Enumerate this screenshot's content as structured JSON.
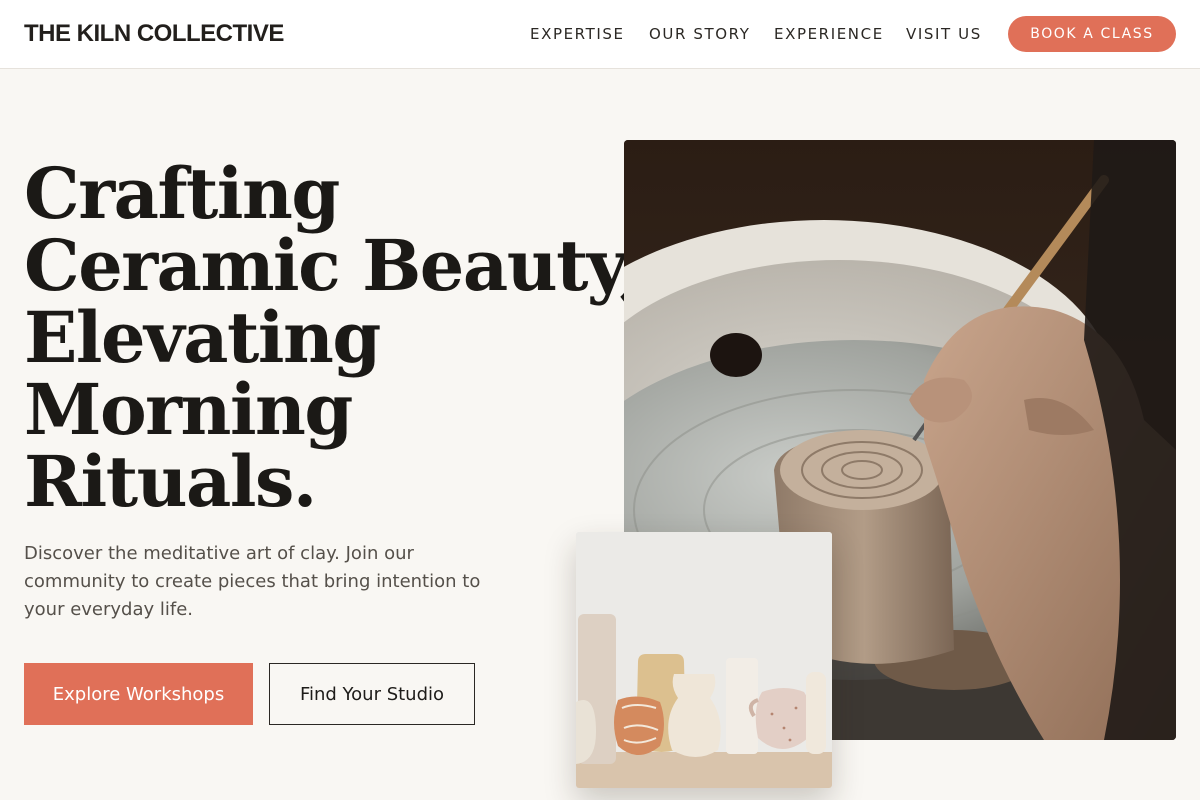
{
  "header": {
    "brand": "THE KILN COLLECTIVE",
    "nav": [
      "EXPERTISE",
      "OUR STORY",
      "EXPERIENCE",
      "VISIT US"
    ],
    "cta": "BOOK A CLASS"
  },
  "hero": {
    "headline": [
      "Crafting",
      "Ceramic Beauty,",
      "Elevating",
      "Morning",
      "Rituals."
    ],
    "description": "Discover the meditative art of clay. Join our community to create pieces that bring intention to your everyday life.",
    "primary_button": "Explore Workshops",
    "secondary_button": "Find Your Studio"
  },
  "colors": {
    "accent": "#e07058",
    "background": "#f9f7f3",
    "text": "#1b1916"
  },
  "images": {
    "main": "pottery-wheel-carving-photo",
    "secondary": "ceramic-vases-collection-photo"
  }
}
